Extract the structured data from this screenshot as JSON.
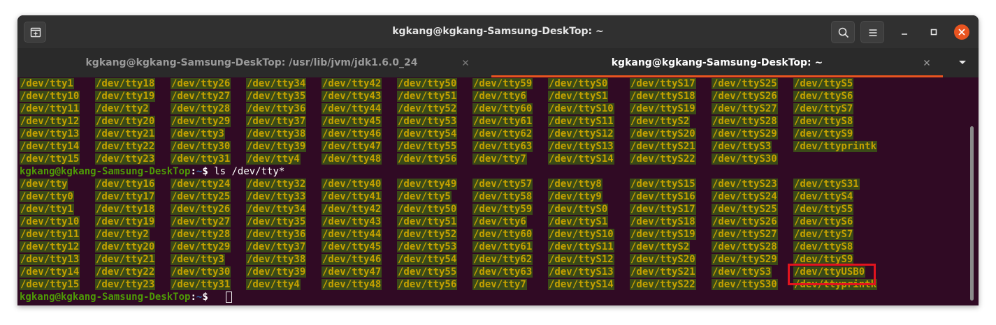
{
  "window": {
    "title": "kgkang@kgkang-Samsung-DeskTop: ~"
  },
  "tabs": [
    {
      "label": "kgkang@kgkang-Samsung-DeskTop: /usr/lib/jvm/jdk1.6.0_24",
      "active": false
    },
    {
      "label": "kgkang@kgkang-Samsung-DeskTop: ~",
      "active": true
    }
  ],
  "icons": {
    "new_tab": "new-tab-icon",
    "search": "search-icon",
    "menu": "hamburger-menu-icon",
    "minimize": "minimize-icon",
    "maximize": "maximize-icon",
    "close": "close-icon",
    "tab_close": "close-icon",
    "tab_list": "chevron-down-icon"
  },
  "colors": {
    "terminal_bg": "#300a24",
    "dir_text": "#c4a000",
    "dir_bg": "#3a4a18",
    "prompt_user": "#4e9a06",
    "prompt_path": "#3465a4",
    "accent": "#e95420",
    "highlight_box": "#e2141e"
  },
  "terminal": {
    "prompt": {
      "user_host": "kgkang@kgkang-Samsung-DeskTop",
      "colon": ":",
      "path": "~",
      "symbol": "$ "
    },
    "command": "ls /dev/tty*",
    "block1": [
      [
        "/dev/tty1",
        "/dev/tty18",
        "/dev/tty26",
        "/dev/tty34",
        "/dev/tty42",
        "/dev/tty50",
        "/dev/tty59",
        "/dev/ttyS0",
        "/dev/ttyS17",
        "/dev/ttyS25",
        "/dev/ttyS5"
      ],
      [
        "/dev/tty10",
        "/dev/tty19",
        "/dev/tty27",
        "/dev/tty35",
        "/dev/tty43",
        "/dev/tty51",
        "/dev/tty6",
        "/dev/ttyS1",
        "/dev/ttyS18",
        "/dev/ttyS26",
        "/dev/ttyS6"
      ],
      [
        "/dev/tty11",
        "/dev/tty2",
        "/dev/tty28",
        "/dev/tty36",
        "/dev/tty44",
        "/dev/tty52",
        "/dev/tty60",
        "/dev/ttyS10",
        "/dev/ttyS19",
        "/dev/ttyS27",
        "/dev/ttyS7"
      ],
      [
        "/dev/tty12",
        "/dev/tty20",
        "/dev/tty29",
        "/dev/tty37",
        "/dev/tty45",
        "/dev/tty53",
        "/dev/tty61",
        "/dev/ttyS11",
        "/dev/ttyS2",
        "/dev/ttyS28",
        "/dev/ttyS8"
      ],
      [
        "/dev/tty13",
        "/dev/tty21",
        "/dev/tty3",
        "/dev/tty38",
        "/dev/tty46",
        "/dev/tty54",
        "/dev/tty62",
        "/dev/ttyS12",
        "/dev/ttyS20",
        "/dev/ttyS29",
        "/dev/ttyS9"
      ],
      [
        "/dev/tty14",
        "/dev/tty22",
        "/dev/tty30",
        "/dev/tty39",
        "/dev/tty47",
        "/dev/tty55",
        "/dev/tty63",
        "/dev/ttyS13",
        "/dev/ttyS21",
        "/dev/ttyS3",
        "/dev/ttyprintk"
      ],
      [
        "/dev/tty15",
        "/dev/tty23",
        "/dev/tty31",
        "/dev/tty4",
        "/dev/tty48",
        "/dev/tty56",
        "/dev/tty7",
        "/dev/ttyS14",
        "/dev/ttyS22",
        "/dev/ttyS30"
      ]
    ],
    "block2": [
      [
        "/dev/tty",
        "/dev/tty16",
        "/dev/tty24",
        "/dev/tty32",
        "/dev/tty40",
        "/dev/tty49",
        "/dev/tty57",
        "/dev/tty8",
        "/dev/ttyS15",
        "/dev/ttyS23",
        "/dev/ttyS31"
      ],
      [
        "/dev/tty0",
        "/dev/tty17",
        "/dev/tty25",
        "/dev/tty33",
        "/dev/tty41",
        "/dev/tty5",
        "/dev/tty58",
        "/dev/tty9",
        "/dev/ttyS16",
        "/dev/ttyS24",
        "/dev/ttyS4"
      ],
      [
        "/dev/tty1",
        "/dev/tty18",
        "/dev/tty26",
        "/dev/tty34",
        "/dev/tty42",
        "/dev/tty50",
        "/dev/tty59",
        "/dev/ttyS0",
        "/dev/ttyS17",
        "/dev/ttyS25",
        "/dev/ttyS5"
      ],
      [
        "/dev/tty10",
        "/dev/tty19",
        "/dev/tty27",
        "/dev/tty35",
        "/dev/tty43",
        "/dev/tty51",
        "/dev/tty6",
        "/dev/ttyS1",
        "/dev/ttyS18",
        "/dev/ttyS26",
        "/dev/ttyS6"
      ],
      [
        "/dev/tty11",
        "/dev/tty2",
        "/dev/tty28",
        "/dev/tty36",
        "/dev/tty44",
        "/dev/tty52",
        "/dev/tty60",
        "/dev/ttyS10",
        "/dev/ttyS19",
        "/dev/ttyS27",
        "/dev/ttyS7"
      ],
      [
        "/dev/tty12",
        "/dev/tty20",
        "/dev/tty29",
        "/dev/tty37",
        "/dev/tty45",
        "/dev/tty53",
        "/dev/tty61",
        "/dev/ttyS11",
        "/dev/ttyS2",
        "/dev/ttyS28",
        "/dev/ttyS8"
      ],
      [
        "/dev/tty13",
        "/dev/tty21",
        "/dev/tty3",
        "/dev/tty38",
        "/dev/tty46",
        "/dev/tty54",
        "/dev/tty62",
        "/dev/ttyS12",
        "/dev/ttyS20",
        "/dev/ttyS29",
        "/dev/ttyS9"
      ],
      [
        "/dev/tty14",
        "/dev/tty22",
        "/dev/tty30",
        "/dev/tty39",
        "/dev/tty47",
        "/dev/tty55",
        "/dev/tty63",
        "/dev/ttyS13",
        "/dev/ttyS21",
        "/dev/ttyS3",
        "/dev/ttyUSB0"
      ],
      [
        "/dev/tty15",
        "/dev/tty23",
        "/dev/tty31",
        "/dev/tty4",
        "/dev/tty48",
        "/dev/tty56",
        "/dev/tty7",
        "/dev/ttyS14",
        "/dev/ttyS22",
        "/dev/ttyS30",
        "/dev/ttyprintk"
      ]
    ]
  }
}
